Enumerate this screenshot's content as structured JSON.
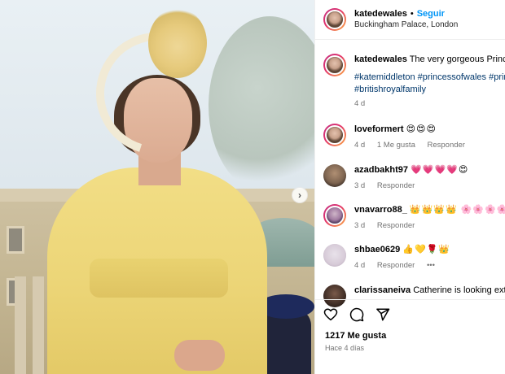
{
  "post": {
    "username": "katedewales",
    "follow_label": "Seguir",
    "location": "Buckingham Palace, London",
    "caption": "The very gorgeous Princess",
    "hashtags_line1": "#katemiddleton #princessofwales #princ",
    "hashtags_line2": "#britishroyalfamily",
    "caption_age": "4 d",
    "likes": "1217 Me gusta",
    "posted": "Hace 4 días"
  },
  "comments": [
    {
      "user": "loveformert",
      "text": "😍😍😍",
      "age": "4 d",
      "likes": "1 Me gusta",
      "reply": "Responder"
    },
    {
      "user": "azadbakht97",
      "text": "💗💗💗💗😍",
      "age": "3 d",
      "likes": "",
      "reply": "Responder"
    },
    {
      "user": "vnavarro88_",
      "text": "👑👑👑👑 🌸🌸🌸🌸🌸",
      "age": "3 d",
      "likes": "",
      "reply": "Responder"
    },
    {
      "user": "shbae0629",
      "text": "👍💛🌹👑",
      "age": "4 d",
      "likes": "",
      "reply": "Responder",
      "more": "•••"
    },
    {
      "user": "clarissaneiva",
      "text": "Catherine is looking extrem",
      "age": "",
      "likes": "",
      "reply": ""
    }
  ],
  "icons": {
    "heart": "heart-icon",
    "comment": "comment-icon",
    "share": "share-icon",
    "carousel": "chevron-right-icon"
  },
  "colors": {
    "accent": "#0095f6",
    "hashtag": "#00376b",
    "muted": "#737373"
  }
}
